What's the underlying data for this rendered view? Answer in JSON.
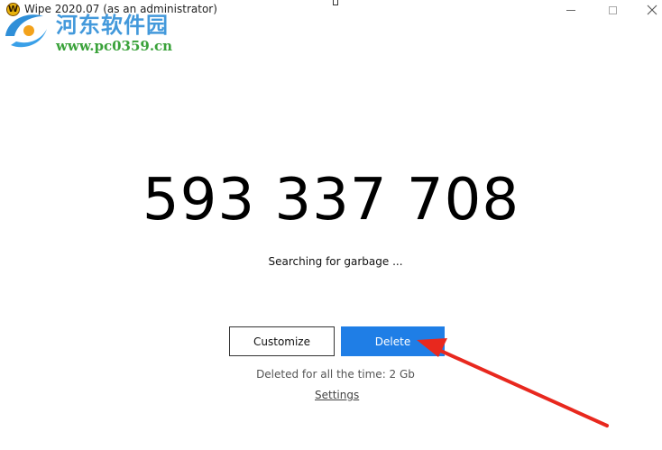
{
  "window": {
    "app_icon_letter": "W",
    "title": "Wipe 2020.07  (as an administrator)"
  },
  "watermark": {
    "site_name": "河东软件园",
    "url": "www.pc0359.cn"
  },
  "main": {
    "counter": "593 337 708",
    "status": "Searching for garbage ...",
    "customize_label": "Customize",
    "delete_label": "Delete",
    "deleted_info": "Deleted for all the time: 2 Gb",
    "settings_label": "Settings"
  },
  "colors": {
    "delete_button": "#1f7ee6",
    "annotation_arrow": "#e8281e"
  }
}
